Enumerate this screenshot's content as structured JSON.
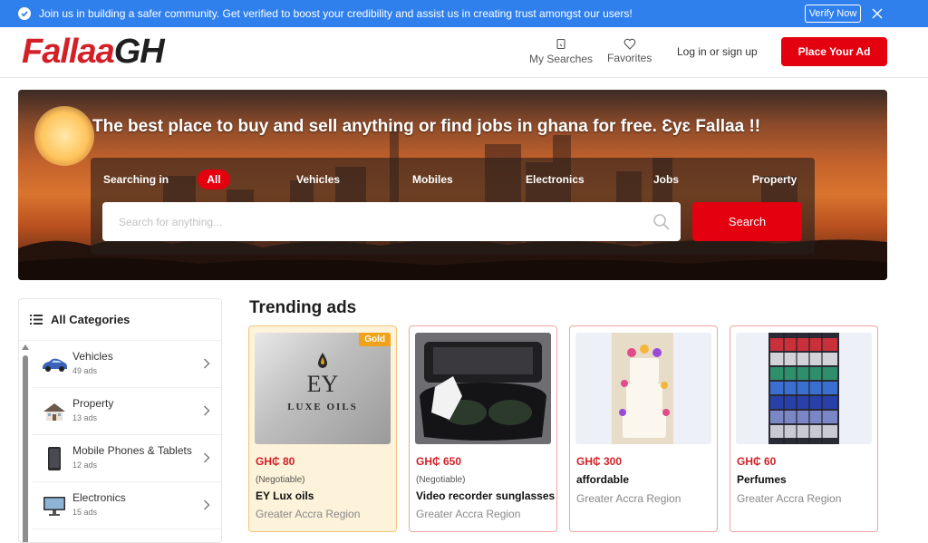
{
  "banner": {
    "message": "Join us in building a safer community. Get verified to boost your credibility and assist us in creating trust amongst our users!",
    "verify_label": "Verify Now"
  },
  "header": {
    "logo_part1": "Fallaa",
    "logo_part2": "GH",
    "my_searches": "My Searches",
    "favorites": "Favorites",
    "login": "Log in or sign up",
    "place_ad": "Place Your Ad"
  },
  "hero": {
    "headline": "The best place to buy and sell anything or find jobs in ghana for free. Ɛyɛ Fallaa !!",
    "searching_in": "Searching in",
    "categories": [
      "All",
      "Vehicles",
      "Mobiles",
      "Electronics",
      "Jobs",
      "Property"
    ],
    "search_placeholder": "Search for anything...",
    "search_button": "Search"
  },
  "sidebar": {
    "title": "All Categories",
    "items": [
      {
        "name": "Vehicles",
        "count": "49 ads",
        "icon": "car-icon"
      },
      {
        "name": "Property",
        "count": "13 ads",
        "icon": "house-icon"
      },
      {
        "name": "Mobile Phones & Tablets",
        "count": "12 ads",
        "icon": "phone-icon"
      },
      {
        "name": "Electronics",
        "count": "15 ads",
        "icon": "monitor-icon"
      }
    ]
  },
  "trending": {
    "title": "Trending ads",
    "ads": [
      {
        "price": "GH₵ 80",
        "negotiable": "(Negotiable)",
        "title": "EY Lux oils",
        "region": "Greater Accra Region",
        "badge": "Gold",
        "image_text": "EY",
        "image_subtext": "LUXE OILS"
      },
      {
        "price": "GH₵ 650",
        "negotiable": "(Negotiable)",
        "title": "Video recorder sunglasses",
        "region": "Greater Accra Region"
      },
      {
        "price": "GH₵ 300",
        "title": "affordable",
        "region": "Greater Accra Region"
      },
      {
        "price": "GH₵ 60",
        "title": "Perfumes",
        "region": "Greater Accra Region"
      }
    ]
  },
  "colors": {
    "accent": "#e3000f",
    "banner": "#2f80ed",
    "gold_badge": "#f0a21a"
  }
}
